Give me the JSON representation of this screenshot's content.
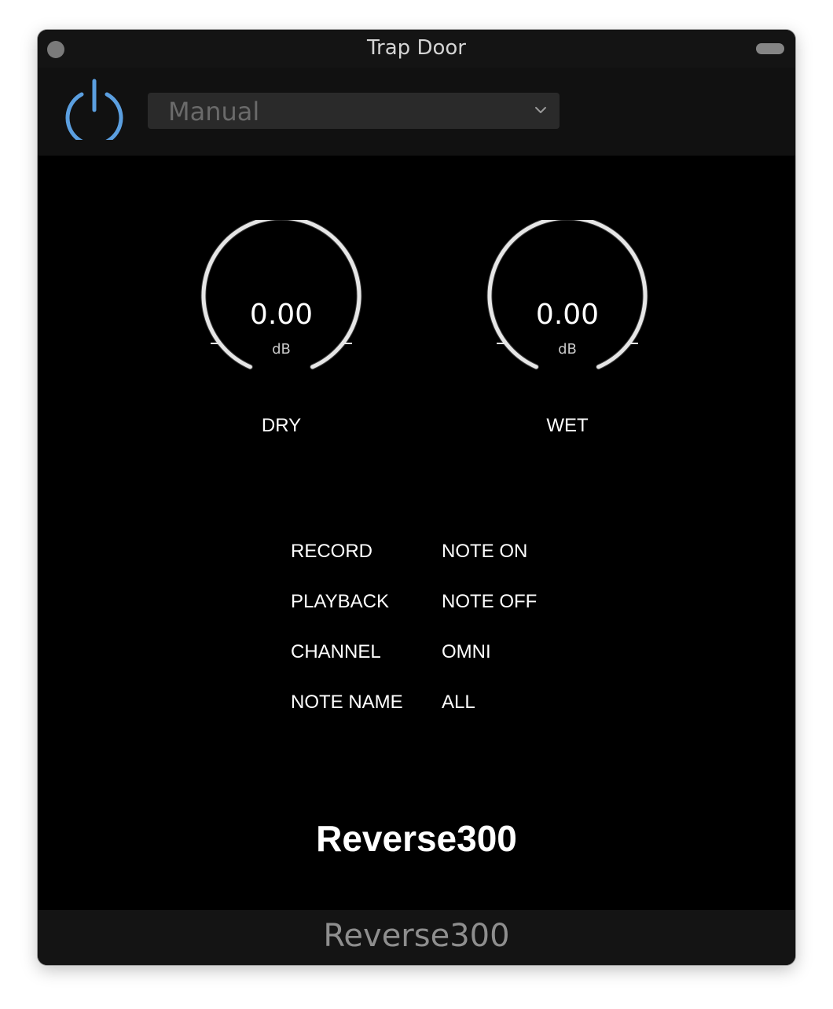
{
  "window": {
    "title": "Trap Door"
  },
  "toolbar": {
    "power_state": "on",
    "preset_value": "Manual"
  },
  "knobs": [
    {
      "label": "DRY",
      "value": "0.00",
      "unit": "dB"
    },
    {
      "label": "WET",
      "value": "0.00",
      "unit": "dB"
    }
  ],
  "params": [
    {
      "name": "RECORD",
      "value": "NOTE ON"
    },
    {
      "name": "PLAYBACK",
      "value": "NOTE OFF"
    },
    {
      "name": "CHANNEL",
      "value": "OMNI"
    },
    {
      "name": "NOTE NAME",
      "value": "ALL"
    }
  ],
  "plugin": {
    "logo_text": "Reverse300"
  },
  "footer": {
    "plugin_name": "Reverse300"
  },
  "colors": {
    "accent": "#5b9fe0",
    "background": "#000000",
    "knob_ring": "#e6e6e6"
  },
  "icons": [
    "power-icon",
    "chevron-down-icon"
  ]
}
